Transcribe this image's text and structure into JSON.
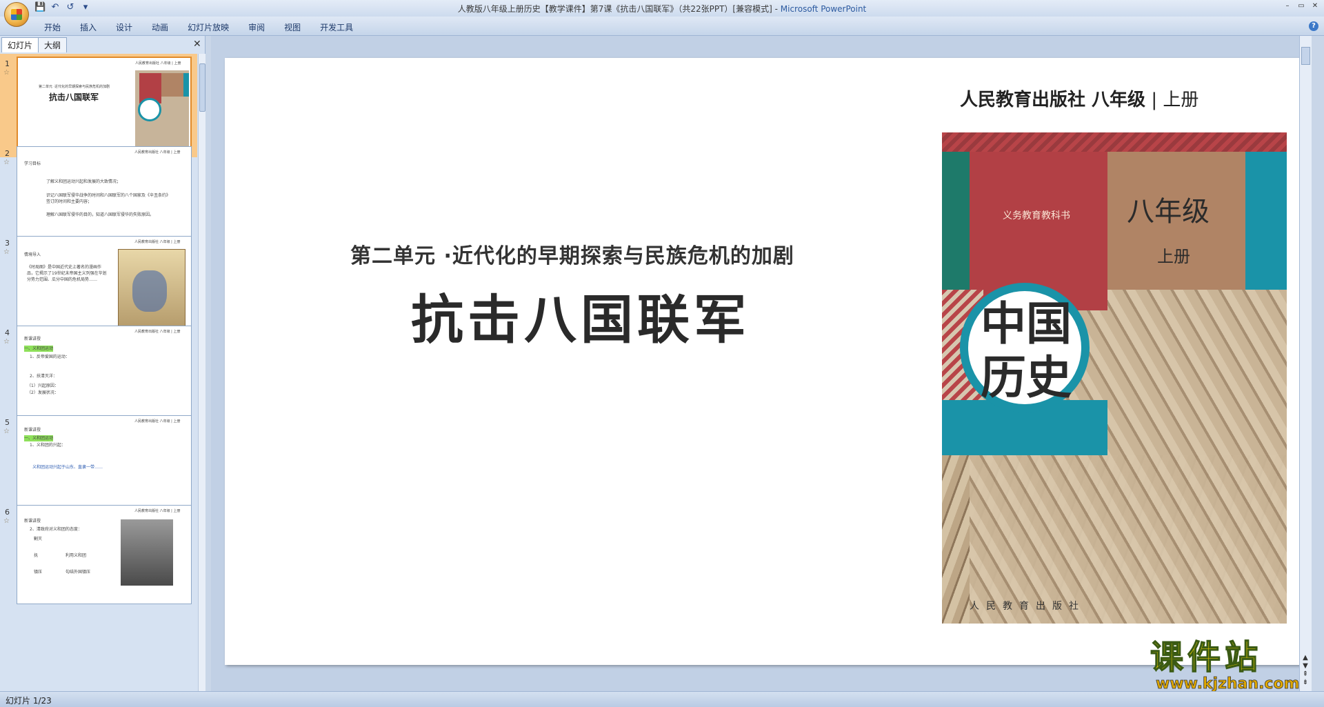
{
  "window": {
    "title_doc": "人教版八年级上册历史【教学课件】第7课《抗击八国联军》（共22张PPT）[兼容模式]",
    "title_sep": " - ",
    "title_app": "Microsoft PowerPoint",
    "controls": [
      "–",
      "▭",
      "✕"
    ]
  },
  "qat": {
    "save": "💾",
    "undo": "↶",
    "redo": "↺",
    "more": "▾"
  },
  "ribbon": {
    "tabs": [
      "开始",
      "插入",
      "设计",
      "动画",
      "幻灯片放映",
      "审阅",
      "视图",
      "开发工具"
    ],
    "help": "?"
  },
  "panel": {
    "tabs": [
      "幻灯片",
      "大纲"
    ],
    "close": "✕",
    "thumbnails": [
      {
        "num": "1",
        "star": "☆",
        "header": "人民教育出版社 八年级 | 上册",
        "unit": "第二单元 ·近代化的早期探索与民族危机的加剧",
        "title": "抗击八国联军"
      },
      {
        "num": "2",
        "star": "☆",
        "header": "人民教育出版社 八年级 | 上册",
        "heading": "学习目标",
        "lines": [
          "了解义和团运动兴起和发展的大致情况；",
          "识记八国联军侵华战争的时间和八国联军的八个国家及《辛丑条约》签订的时间和主要内容；",
          "理解八国联军侵华的目的，知道八国联军侵华的失败原因。"
        ]
      },
      {
        "num": "3",
        "star": "☆",
        "header": "人民教育出版社 八年级 | 上册",
        "heading": "情境导入",
        "lines": [
          "《时局图》是中国近代史上著名的漫画作品，它揭示了19世纪末帝国主义列强在华划分势力范围、瓜分中国的危机局势……"
        ]
      },
      {
        "num": "4",
        "star": "☆",
        "header": "人民教育出版社 八年级 | 上册",
        "heading": "新课讲授",
        "lines": [
          "一、义和团运动",
          "1、反帝爱国的运动：",
          "2、扶清灭洋：",
          "（1）兴起原因：",
          "（2）发展状况："
        ]
      },
      {
        "num": "5",
        "star": "☆",
        "header": "人民教育出版社 八年级 | 上册",
        "heading": "新课讲授",
        "lines": [
          "一、义和团运动",
          "1、义和团的兴起：",
          "义和团运动兴起于山东、直隶一带……"
        ]
      },
      {
        "num": "6",
        "star": "☆",
        "header": "人民教育出版社 八年级 | 上册",
        "heading": "新课讲授",
        "lines": [
          "2、清政府对义和团的态度：",
          "剿灭",
          "抚",
          "利用义和团",
          "镇压",
          "勾结外国镇压"
        ]
      }
    ]
  },
  "slide": {
    "publisher": "人民教育出版社 八年级",
    "publisher_sep": " | ",
    "publisher_vol": "上册",
    "unit": "第二单元 ·近代化的早期探索与民族危机的加剧",
    "lesson": "抗击八国联军",
    "cover": {
      "textbook": "义务教育教科书",
      "grade": "八年级",
      "volume": "上册",
      "title": "中国历史",
      "publisher": "人民教育出版社"
    }
  },
  "watermark": {
    "name": "课件站",
    "url": "www.kjzhan.com"
  },
  "status": {
    "slide_count": "幻灯片 1/23"
  },
  "colors": {
    "cover_red": "#b24045",
    "cover_teal": "#1a93a8",
    "cover_green": "#1e7a6a",
    "cover_tan": "#b08465",
    "selection": "#f9c98a"
  }
}
